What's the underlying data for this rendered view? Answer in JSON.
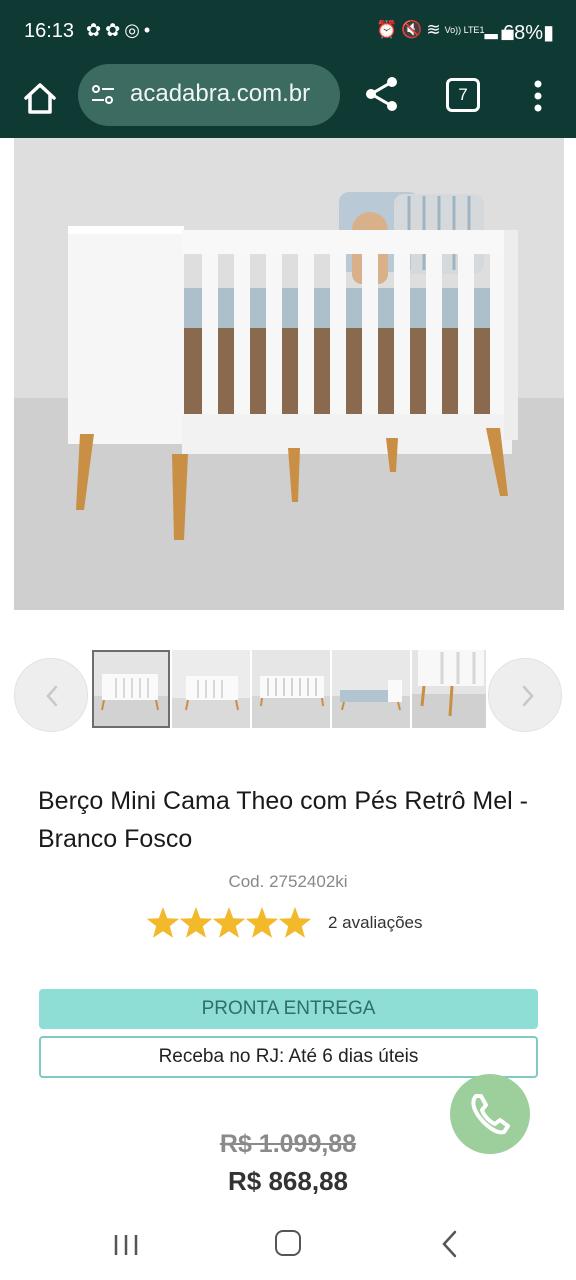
{
  "status_bar": {
    "time": "16:13",
    "left_icons": [
      "flower-icon",
      "flower-icon",
      "sync-icon",
      "dot-icon"
    ],
    "right_icons": [
      "alarm-icon",
      "mute-icon",
      "wifi-icon",
      "volte-icon",
      "signal-icon"
    ],
    "lte_label": "Vo)) LTE1",
    "battery": "68%"
  },
  "toolbar": {
    "url": "acadabra.com.br",
    "tab_count": "7"
  },
  "product": {
    "title": "Berço Mini Cama Theo com Pés Retrô Mel - Branco Fosco",
    "code": "Cod. 2752402ki",
    "rating": 5,
    "rating_max": 5,
    "reviews": "2 avaliações",
    "availability": "PRONTA ENTREGA",
    "delivery": "Receba no RJ: Até 6 dias úteis",
    "old_price": "R$ 1.099,88",
    "price": "R$ 868,88"
  },
  "thumbnails": {
    "count": 5,
    "selected_index": 0
  },
  "colors": {
    "top_bar": "#0f3a33",
    "url_bar": "#3b6b61",
    "ready_badge": "#8fded5",
    "star": "#f2b92b",
    "whatsapp": "#9ccf9c"
  }
}
